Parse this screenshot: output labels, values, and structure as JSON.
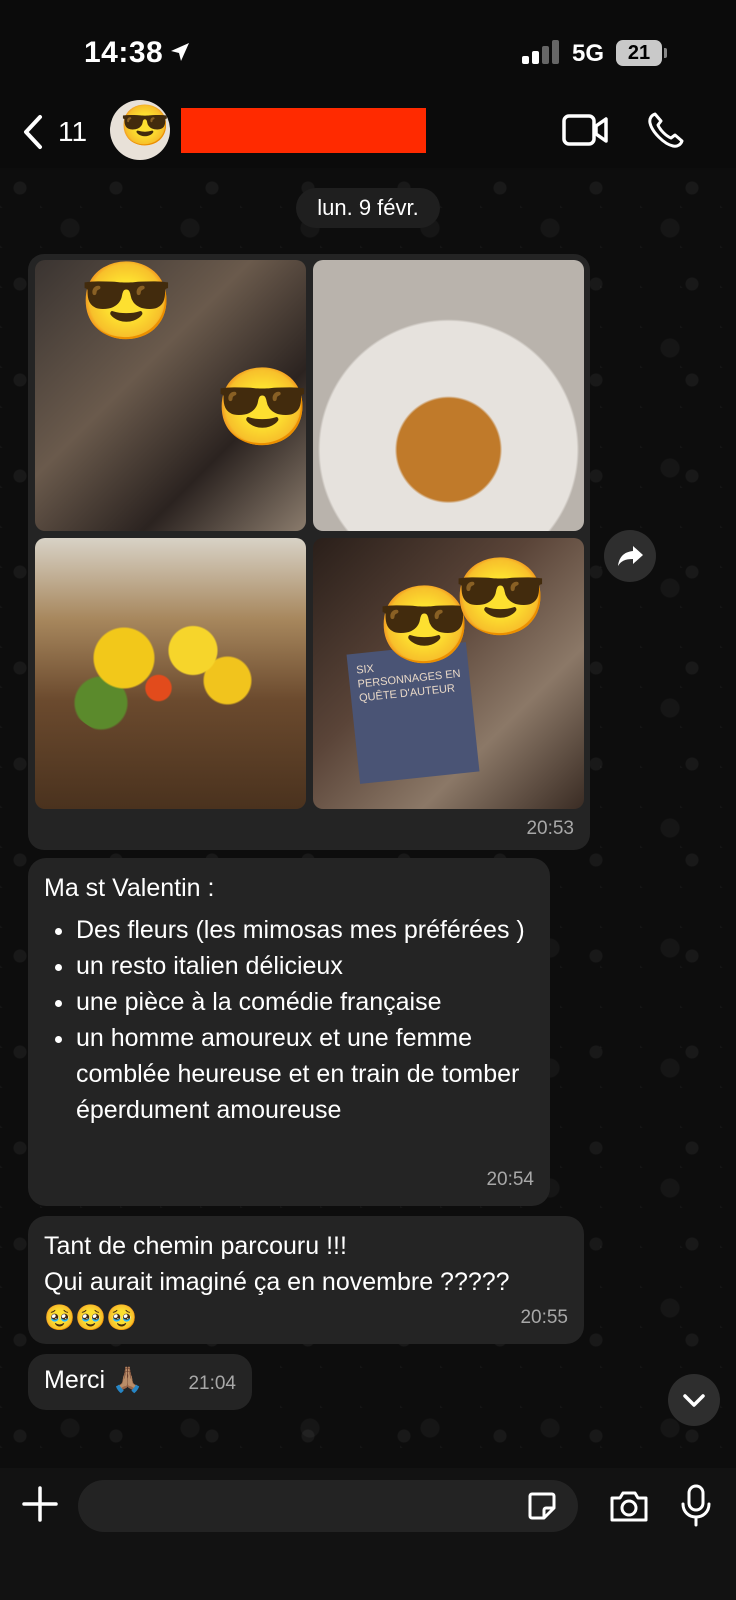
{
  "status_bar": {
    "time": "14:38",
    "network": "5G",
    "battery": "21"
  },
  "header": {
    "back_count": "11"
  },
  "date_label": "lun. 9 févr.",
  "messages": {
    "photos": {
      "time": "20:53",
      "book_text": "SIX PERSONNAGES EN QUÊTE D'AUTEUR"
    },
    "msg2": {
      "intro": "Ma st Valentin :",
      "items": [
        "Des fleurs (les mimosas mes préférées )",
        "un resto italien délicieux",
        "une pièce à la comédie française",
        "un homme amoureux et une femme comblée heureuse et en train de tomber éperdument amoureuse"
      ],
      "time": "20:54"
    },
    "msg3": {
      "line1": "Tant de chemin parcouru !!!",
      "line2": "Qui aurait imaginé ça en novembre ?????",
      "emojis": "🥹🥹🥹",
      "time": "20:55"
    },
    "msg4": {
      "text": "Merci 🙏🏽",
      "time": "21:04"
    }
  },
  "composer": {
    "placeholder": ""
  },
  "colors": {
    "bubble": "#242424",
    "background": "#0b0b0b",
    "redaction": "#ff2a00"
  },
  "icons": [
    "location-arrow-icon",
    "back-chevron-icon",
    "video-icon",
    "phone-icon",
    "share-icon",
    "chevron-down-icon",
    "plus-icon",
    "sticker-icon",
    "camera-icon",
    "mic-icon"
  ]
}
